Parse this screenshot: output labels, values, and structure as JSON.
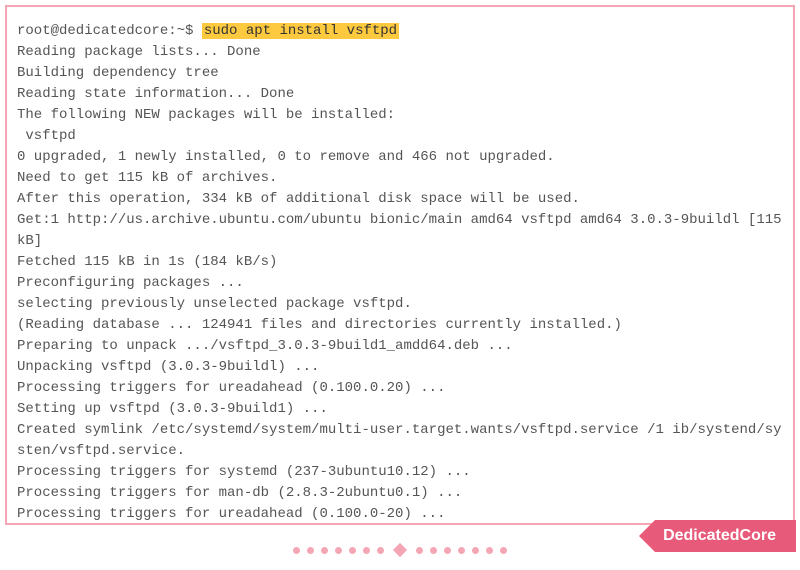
{
  "terminal": {
    "prompt": "root@dedicatedcore:~$ ",
    "command": "sudo apt install vsftpd",
    "output": [
      "Reading package lists... Done",
      "Building dependency tree",
      "Reading state information... Done",
      "The following NEW packages will be installed:",
      " vsftpd",
      "0 upgraded, 1 newly installed, 0 to remove and 466 not upgraded.",
      "Need to get 115 kB of archives.",
      "After this operation, 334 kB of additional disk space will be used.",
      "Get:1 http://us.archive.ubuntu.com/ubuntu bionic/main amd64 vsftpd amd64 3.0.3-9buildl [115 kB]",
      "Fetched 115 kB in 1s (184 kB/s)",
      "Preconfiguring packages ...",
      "selecting previously unselected package vsftpd.",
      "(Reading database ... 124941 files and directories currently installed.)",
      "Preparing to unpack .../vsftpd_3.0.3-9build1_amdd64.deb ...",
      "Unpacking vsftpd (3.0.3-9buildl) ...",
      "Processing triggers for ureadahead (0.100.0.20) ...",
      "Setting up vsftpd (3.0.3-9build1) ...",
      "Created symlink /etc/systemd/system/multi-user.target.wants/vsftpd.service /1 ib/systend/systen/vsftpd.service.",
      "Processing triggers for systemd (237-3ubuntu10.12) ...",
      "Processing triggers for man-db (2.8.3-2ubuntu0.1) ...",
      "Processing triggers for ureadahead (0.100.0-20) ..."
    ]
  },
  "brand": "DedicatedCore"
}
